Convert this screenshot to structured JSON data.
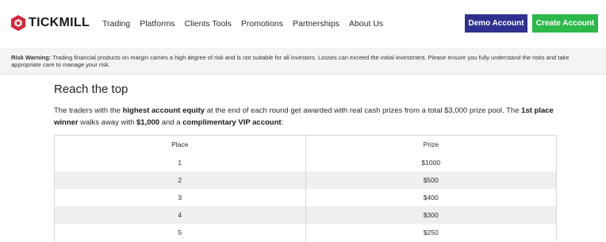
{
  "brand": {
    "name": "TICKMILL",
    "logo_color": "#d7263d"
  },
  "nav": {
    "items": [
      {
        "label": "Trading"
      },
      {
        "label": "Platforms"
      },
      {
        "label": "Clients Tools"
      },
      {
        "label": "Promotions"
      },
      {
        "label": "Partnerships"
      },
      {
        "label": "About Us"
      }
    ]
  },
  "header_buttons": {
    "demo_label": "Demo Account",
    "create_label": "Create Account",
    "demo_color": "#2f318f",
    "create_color": "#2db84a"
  },
  "risk": {
    "label": "Risk Warning:",
    "text": " Trading financial products on margin carries a high degree of risk and is not suitable for all investors. Losses can exceed the initial investment. Please ensure you fully understand the risks and take appropriate care to manage your risk."
  },
  "section": {
    "title": "Reach the top",
    "p1": "The traders with the ",
    "p1_bold": "highest account equity",
    "p2": " at the end of each round get awarded with real cash prizes from a total $3,000 prize pool. The ",
    "p2_bold": "1st place winner",
    "p3": " walks away with ",
    "p3_bold": "$1,000",
    "p4": " and a ",
    "p4_bold": "complimentary VIP account",
    "p5": ":"
  },
  "table": {
    "headers": [
      "Place",
      "Prize"
    ],
    "rows": [
      [
        "1",
        "$1000"
      ],
      [
        "2",
        "$500"
      ],
      [
        "3",
        "$400"
      ],
      [
        "4",
        "$300"
      ],
      [
        "5",
        "$250"
      ]
    ]
  }
}
